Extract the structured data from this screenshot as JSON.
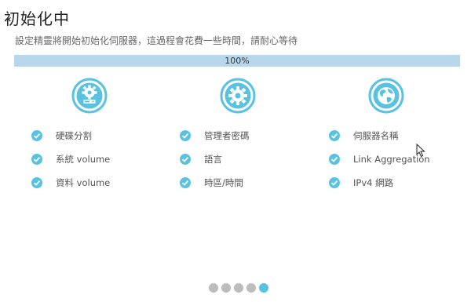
{
  "title": "初始化中",
  "subtitle": "設定精靈將開始初始化伺服器，這過程會花費一些時間，請耐心等待",
  "progress": {
    "label": "100%",
    "value": 1.0
  },
  "colors": {
    "accent": "#59c2e0",
    "progress_fill": "#b9d7ec",
    "dot_inactive": "#bdbdbd"
  },
  "columns": [
    {
      "icon": "storage-gear-icon",
      "items": [
        "硬碟分割",
        "系統 volume",
        "資料 volume"
      ]
    },
    {
      "icon": "gear-icon",
      "items": [
        "管理者密碼",
        "語言",
        "時區/時間"
      ]
    },
    {
      "icon": "globe-icon",
      "items": [
        "伺服器名稱",
        "Link Aggregation",
        "IPv4 網路"
      ]
    }
  ],
  "pagination": {
    "total": 5,
    "active": 5
  }
}
